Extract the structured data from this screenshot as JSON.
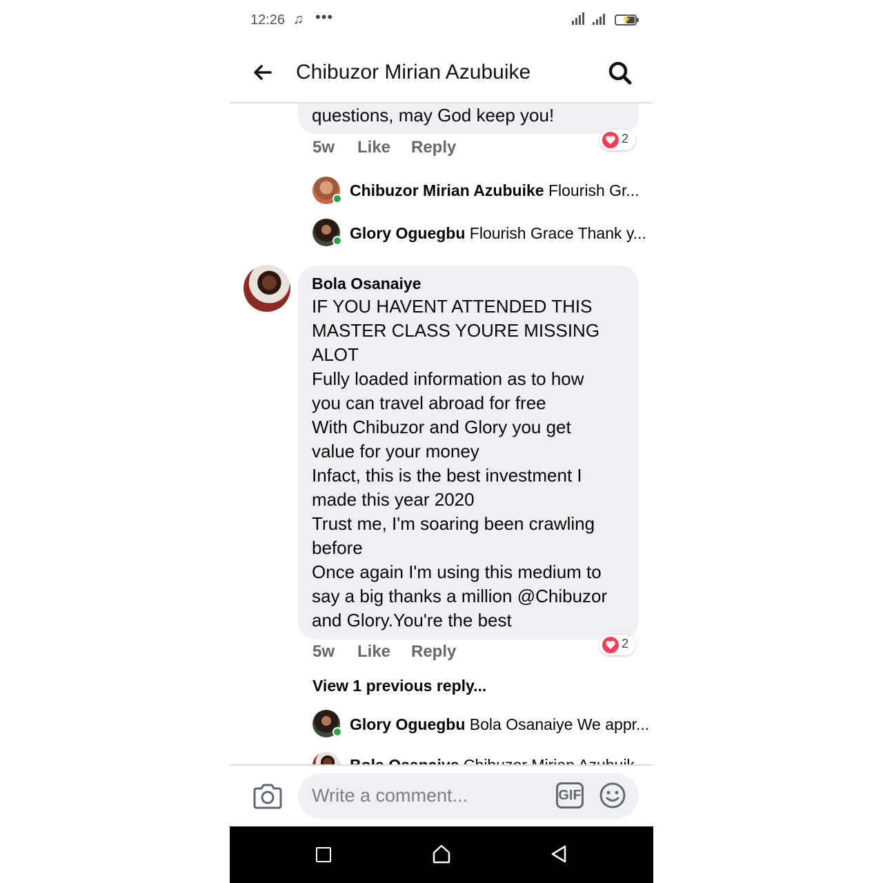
{
  "status_bar": {
    "time": "12:26",
    "music_icon": "music-note-icon",
    "more_icon": "more-dots-icon"
  },
  "header": {
    "title": "Chibuzor Mirian Azubuike",
    "back_icon": "back-arrow-icon",
    "search_icon": "search-icon"
  },
  "top_comment": {
    "text_tail": "questions, may God keep you!",
    "age": "5w",
    "like_label": "Like",
    "reply_label": "Reply",
    "reaction_count": "2"
  },
  "top_replies": [
    {
      "author": "Chibuzor Mirian Azubuike",
      "preview": "Flourish Gr..."
    },
    {
      "author": "Glory Oguegbu",
      "preview": "Flourish Grace Thank y..."
    }
  ],
  "main_comment": {
    "author": "Bola Osanaiye",
    "lines": [
      "IF YOU HAVENT ATTENDED THIS",
      "MASTER CLASS YOURE MISSING",
      "ALOT",
      "Fully loaded information as to how",
      "you can travel abroad for free",
      "With Chibuzor and Glory you get",
      "value for your money",
      "Infact, this is the best investment I",
      "made this year 2020",
      "Trust me, I'm soaring been crawling",
      "before",
      "Once again I'm using this medium to",
      "say a big thanks a million @Chibuzor",
      "and Glory.You're the best"
    ],
    "age": "5w",
    "like_label": "Like",
    "reply_label": "Reply",
    "reaction_count": "2"
  },
  "view_previous": "View 1 previous reply...",
  "bottom_replies": [
    {
      "author": "Glory Oguegbu",
      "preview": "Bola Osanaiye We appr..."
    },
    {
      "author": "Bola Osanaiye",
      "preview": "Chibuzor Mirian Azubuik..."
    }
  ],
  "composer": {
    "placeholder": "Write a comment...",
    "gif_label": "GIF"
  },
  "colors": {
    "bubble": "#eff0f3",
    "heart": "#f33e58",
    "online": "#31a24c",
    "meta": "#65676b"
  }
}
